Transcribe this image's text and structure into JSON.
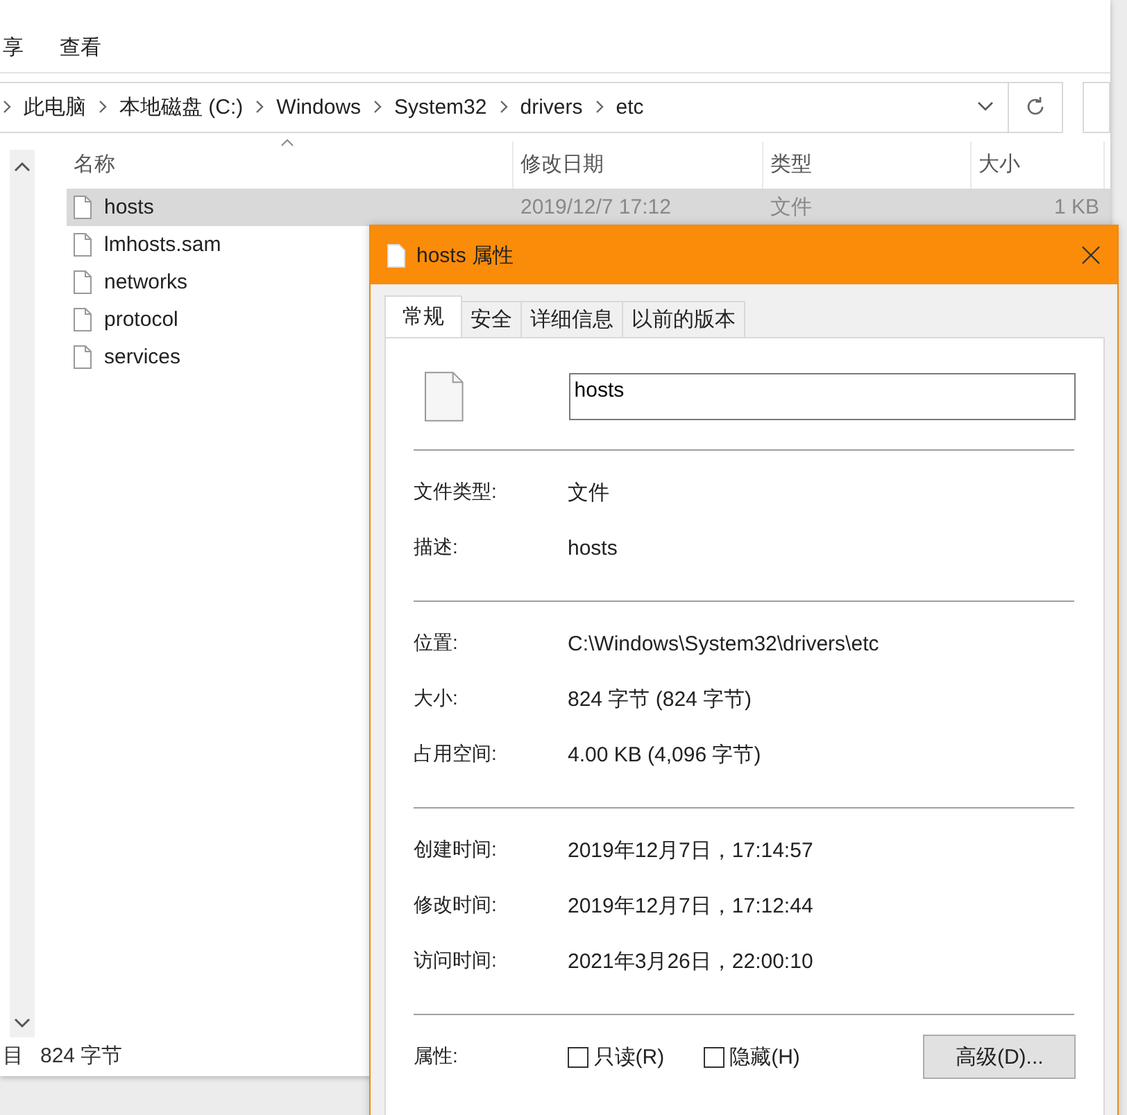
{
  "ribbon": {
    "tabs": [
      {
        "label": "享",
        "selected": false
      },
      {
        "label": "查看",
        "selected": false
      }
    ]
  },
  "address_bar": {
    "crumbs": [
      "此电脑",
      "本地磁盘 (C:)",
      "Windows",
      "System32",
      "drivers",
      "etc"
    ]
  },
  "file_list": {
    "columns": [
      {
        "label": "名称",
        "sorted": true
      },
      {
        "label": "修改日期",
        "sorted": false
      },
      {
        "label": "类型",
        "sorted": false
      },
      {
        "label": "大小",
        "sorted": false
      }
    ],
    "rows": [
      {
        "name": "hosts",
        "modified": "2019/12/7 17:12",
        "type": "文件",
        "size": "1 KB",
        "selected": true
      },
      {
        "name": "lmhosts.sam",
        "selected": false
      },
      {
        "name": "networks",
        "selected": false
      },
      {
        "name": "protocol",
        "selected": false
      },
      {
        "name": "services",
        "selected": false
      }
    ]
  },
  "status_bar": {
    "items": [
      "目",
      "824 字节"
    ]
  },
  "dialog": {
    "title": "hosts 属性",
    "tabs": [
      {
        "label": "常规",
        "selected": true
      },
      {
        "label": "安全",
        "selected": false
      },
      {
        "label": "详细信息",
        "selected": false
      },
      {
        "label": "以前的版本",
        "selected": false
      }
    ],
    "file_name": "hosts",
    "sections": [
      [
        {
          "label": "文件类型:",
          "value": "文件"
        },
        {
          "label": "描述:",
          "value": "hosts"
        }
      ],
      [
        {
          "label": "位置:",
          "value": "C:\\Windows\\System32\\drivers\\etc"
        },
        {
          "label": "大小:",
          "value": "824 字节 (824 字节)"
        },
        {
          "label": "占用空间:",
          "value": "4.00 KB (4,096 字节)"
        }
      ],
      [
        {
          "label": "创建时间:",
          "value": "2019年12月7日，17:14:57"
        },
        {
          "label": "修改时间:",
          "value": "2019年12月7日，17:12:44"
        },
        {
          "label": "访问时间:",
          "value": "2021年3月26日，22:00:10"
        }
      ]
    ],
    "attributes": {
      "label": "属性:",
      "checkboxes": [
        {
          "label": "只读(R)",
          "checked": false
        },
        {
          "label": "隐藏(H)",
          "checked": false
        }
      ],
      "button": "高级(D)..."
    }
  }
}
